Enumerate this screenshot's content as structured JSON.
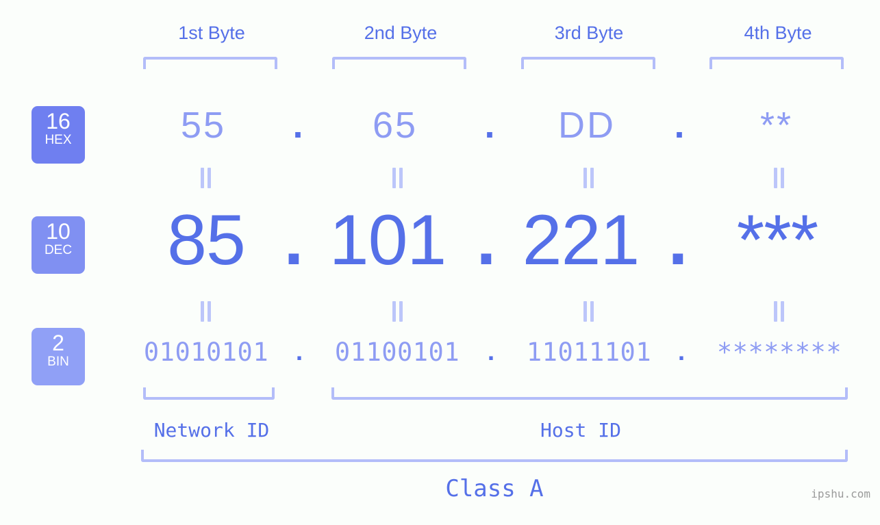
{
  "meta": {
    "watermark": "ipshu.com",
    "background_color": "#fbfefb",
    "primary_color": "#5570e8",
    "secondary_color": "#8e9cf3",
    "bracket_color": "#b3bdf9"
  },
  "byte_headers": [
    {
      "label": "1st Byte"
    },
    {
      "label": "2nd Byte"
    },
    {
      "label": "3rd Byte"
    },
    {
      "label": "4th Byte"
    }
  ],
  "bases": [
    {
      "number": "16",
      "name": "HEX",
      "color": "#6f7ff0"
    },
    {
      "number": "10",
      "name": "DEC",
      "color": "#8090f2"
    },
    {
      "number": "2",
      "name": "BIN",
      "color": "#90a0f6"
    }
  ],
  "rows": {
    "hex": {
      "base_number": "16",
      "base_name": "HEX",
      "octets": [
        "55",
        "65",
        "DD",
        "**"
      ],
      "separators": [
        ".",
        ".",
        "."
      ]
    },
    "dec": {
      "base_number": "10",
      "base_name": "DEC",
      "octets": [
        "85",
        "101",
        "221",
        "***"
      ],
      "separators": [
        ".",
        ".",
        "."
      ]
    },
    "bin": {
      "base_number": "2",
      "base_name": "BIN",
      "octets": [
        "01010101",
        "01100101",
        "11011101",
        "********"
      ],
      "separators": [
        ".",
        ".",
        "."
      ]
    }
  },
  "sections": {
    "network_id": "Network ID",
    "host_id": "Host ID",
    "class": "Class A"
  }
}
